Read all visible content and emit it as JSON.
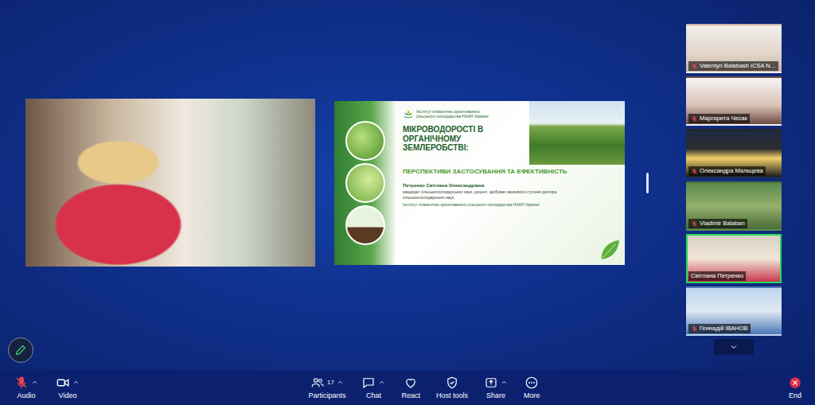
{
  "slide": {
    "logo_text": "Інститут кліматично орієнтованого сільського господарства НААН України",
    "title": "МІКРОВОДОРОСТІ В ОРГАНІЧНОМУ ЗЕМЛЕРОБСТВІ:",
    "subtitle": "ПЕРСПЕКТИВИ ЗАСТОСУВАННЯ ТА ЕФЕКТИВНІСТЬ",
    "author": "Петренко Світлана Олександрівна",
    "credentials": "кандидат сільськогосподарських наук, доцент, здобувач наукового ступеня доктора сільськогосподарських наук,",
    "affiliation": "Інститут кліматично орієнтованого сільського господарства НААН України"
  },
  "participants": [
    {
      "name": "Valentyn Balabash ICSA N…",
      "muted": true,
      "selected": false
    },
    {
      "name": "Маргарита Чесак",
      "muted": true,
      "selected": false
    },
    {
      "name": "Олександра Мальцева",
      "muted": true,
      "selected": false
    },
    {
      "name": "Vladimir Balaban",
      "muted": true,
      "selected": false
    },
    {
      "name": "Світлана Петренко",
      "muted": false,
      "selected": true
    },
    {
      "name": "Геннадій ІВАНОВ",
      "muted": true,
      "selected": false
    }
  ],
  "toolbar": {
    "media": [
      {
        "label": "Audio",
        "kind": "audio",
        "muted": true,
        "menu": true
      },
      {
        "label": "Video",
        "kind": "video",
        "muted": false,
        "menu": true
      }
    ],
    "controls": [
      {
        "label": "Participants",
        "kind": "participants",
        "badge": "17",
        "menu": true
      },
      {
        "label": "Chat",
        "kind": "chat",
        "menu": true
      },
      {
        "label": "React",
        "kind": "react",
        "menu": false
      },
      {
        "label": "Host tools",
        "kind": "host",
        "menu": false
      },
      {
        "label": "Share",
        "kind": "share",
        "menu": true
      },
      {
        "label": "More",
        "kind": "more",
        "menu": false
      }
    ],
    "end": {
      "label": "End"
    }
  }
}
